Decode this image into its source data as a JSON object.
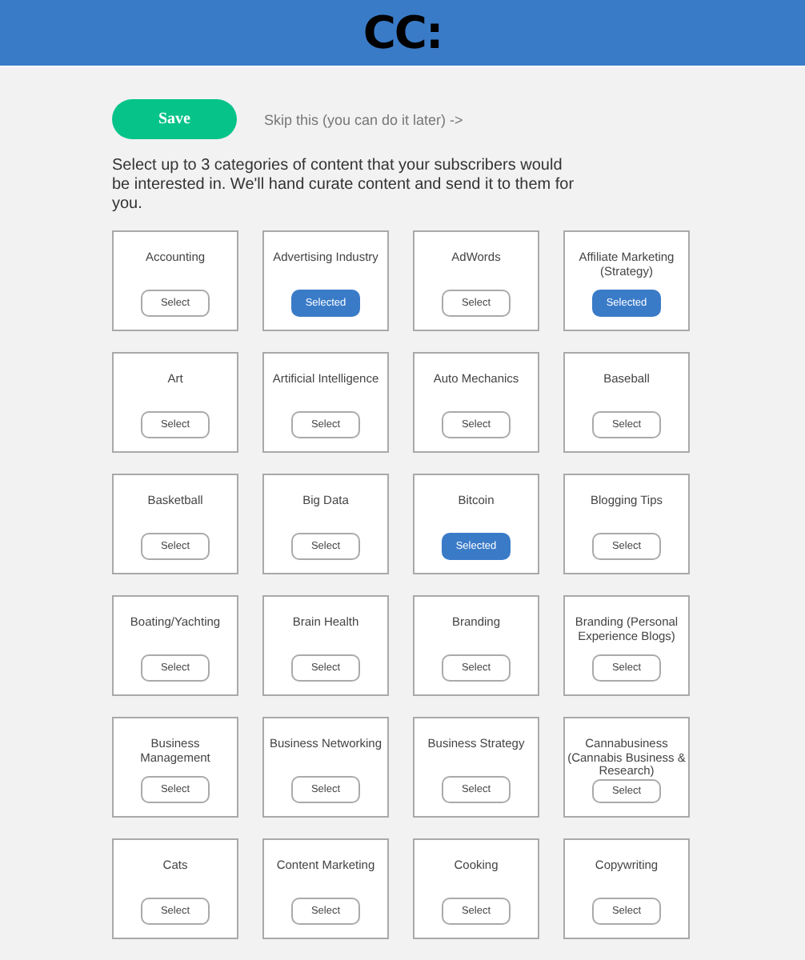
{
  "header": {
    "logo": "CC:"
  },
  "actions": {
    "save": "Save",
    "skip": "Skip this (you can do it later) ->"
  },
  "instructions": "Select up to 3 categories of content that your subscribers would be interested in. We'll hand curate content and send it to them for you.",
  "categories": [
    {
      "name": "Accounting",
      "button": "Select",
      "selected": false
    },
    {
      "name": "Advertising Industry",
      "button": "Selected",
      "selected": true
    },
    {
      "name": "AdWords",
      "button": "Select",
      "selected": false
    },
    {
      "name": "Affiliate Marketing (Strategy)",
      "button": "Selected",
      "selected": true
    },
    {
      "name": "Art",
      "button": "Select",
      "selected": false
    },
    {
      "name": "Artificial Intelligence",
      "button": "Select",
      "selected": false
    },
    {
      "name": "Auto Mechanics",
      "button": "Select",
      "selected": false
    },
    {
      "name": "Baseball",
      "button": "Select",
      "selected": false
    },
    {
      "name": "Basketball",
      "button": "Select",
      "selected": false
    },
    {
      "name": "Big Data",
      "button": "Select",
      "selected": false
    },
    {
      "name": "Bitcoin",
      "button": "Selected",
      "selected": true
    },
    {
      "name": "Blogging Tips",
      "button": "Select",
      "selected": false
    },
    {
      "name": "Boating/Yachting",
      "button": "Select",
      "selected": false
    },
    {
      "name": "Brain Health",
      "button": "Select",
      "selected": false
    },
    {
      "name": "Branding",
      "button": "Select",
      "selected": false
    },
    {
      "name": "Branding (Personal Experience Blogs)",
      "button": "Select",
      "selected": false
    },
    {
      "name": "Business Management",
      "button": "Select",
      "selected": false
    },
    {
      "name": "Business Networking",
      "button": "Select",
      "selected": false
    },
    {
      "name": "Business Strategy",
      "button": "Select",
      "selected": false
    },
    {
      "name": "Cannabusiness (Cannabis Business & Research)",
      "button": "Select",
      "selected": false
    },
    {
      "name": "Cats",
      "button": "Select",
      "selected": false
    },
    {
      "name": "Content Marketing",
      "button": "Select",
      "selected": false
    },
    {
      "name": "Cooking",
      "button": "Select",
      "selected": false
    },
    {
      "name": "Copywriting",
      "button": "Select",
      "selected": false
    }
  ]
}
